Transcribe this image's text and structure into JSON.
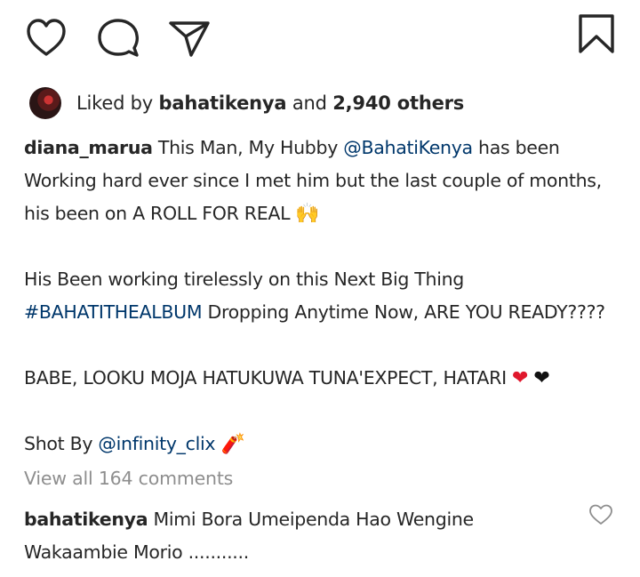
{
  "actions": {
    "like": "heart-outline-icon",
    "comment": "comment-bubble-icon",
    "share": "paper-plane-icon",
    "save": "bookmark-icon"
  },
  "likes": {
    "prefix": "Liked by",
    "user": "bahatikenya",
    "conjunction": "and",
    "others": "2,940 others"
  },
  "caption": {
    "author": "diana_marua",
    "line1_a": "This Man, My Hubby",
    "mention1": "@BahatiKenya",
    "line1_b": "has been Working hard ever since I met him but the last couple of months, his been on A ROLL FOR REAL",
    "emoji_hands": "🙌",
    "para2_a": "His Been working tirelessly on this Next Big Thing",
    "hashtag": "#BAHATITHEALBUM",
    "para2_b": "Dropping Anytime Now, ARE YOU READY????",
    "para3": "BABE, LOOKU MOJA HATUKUWA TUNA'EXPECT, HATARI",
    "heart_red": "❤",
    "heart_black": "❤",
    "para4_prefix": "Shot By",
    "mention2": "@infinity_clix",
    "emoji_firecracker": "🧨"
  },
  "view_comments": "View all 164 comments",
  "comment": {
    "user": "bahatikenya",
    "text": "Mimi Bora Umeipenda Hao Wengine Wakaambie Morio ..........."
  },
  "colors": {
    "text": "#262626",
    "link": "#00376b",
    "muted": "#8e8e8e",
    "heart_red": "#e0182d"
  }
}
